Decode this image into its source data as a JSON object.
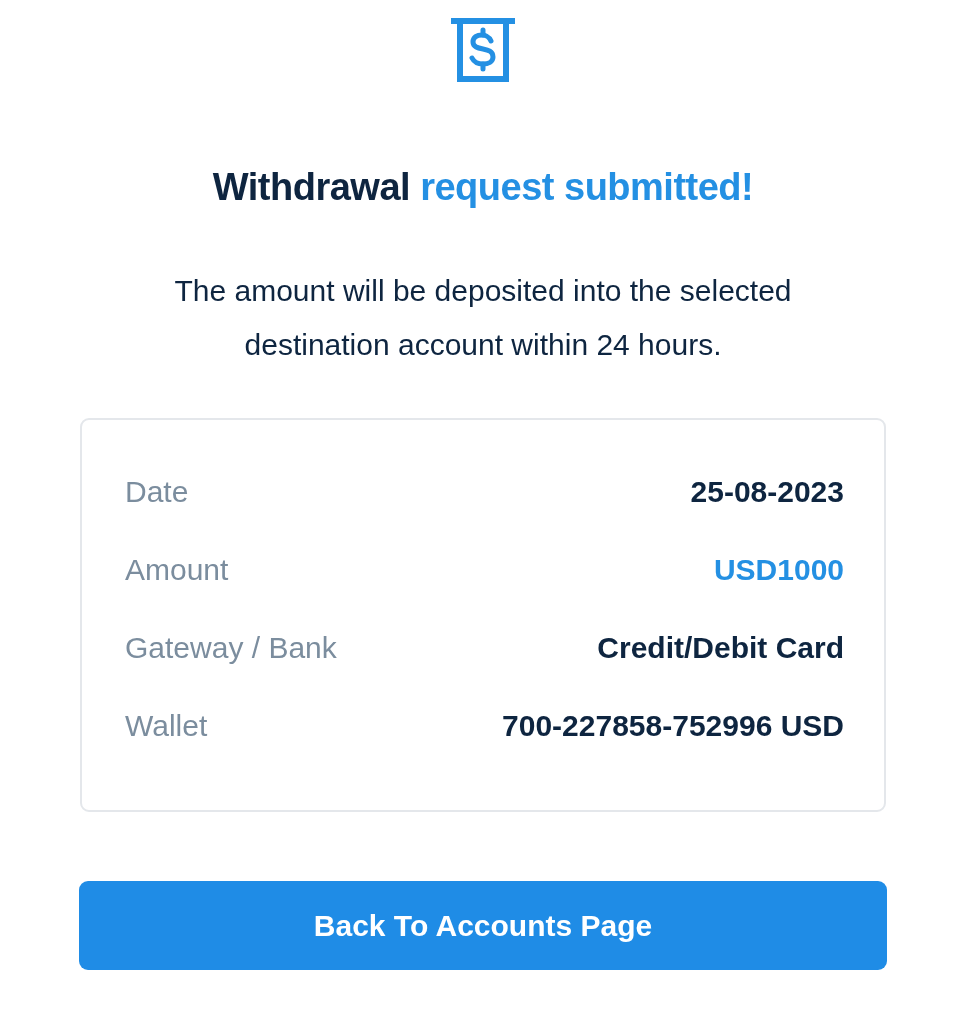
{
  "header": {
    "title_lead": "Withdrawal",
    "title_highlight": "request submitted!"
  },
  "message": "The amount will be deposited into the selected destination account within 24 hours.",
  "details": [
    {
      "label": "Date",
      "value": "25-08-2023",
      "highlighted": false
    },
    {
      "label": "Amount",
      "value": "USD1000",
      "highlighted": true
    },
    {
      "label": "Gateway / Bank",
      "value": "Credit/Debit Card",
      "highlighted": false
    },
    {
      "label": "Wallet",
      "value": "700-227858-752996 USD",
      "highlighted": false
    }
  ],
  "button": {
    "label": "Back To Accounts Page"
  }
}
